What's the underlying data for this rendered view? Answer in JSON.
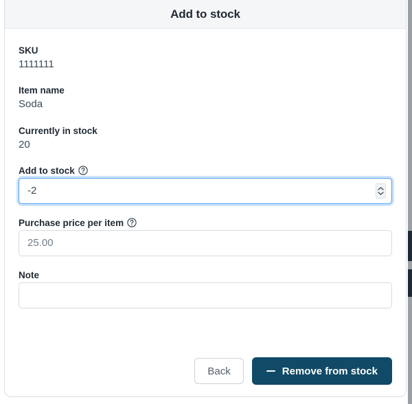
{
  "modal": {
    "title": "Add to stock"
  },
  "fields": {
    "sku": {
      "label": "SKU",
      "value": "1111111"
    },
    "item_name": {
      "label": "Item name",
      "value": "Soda"
    },
    "currently_in_stock": {
      "label": "Currently in stock",
      "value": "20"
    },
    "add_to_stock": {
      "label": "Add to stock",
      "help_icon": "help-circle-icon",
      "value": "-2",
      "placeholder": ""
    },
    "purchase_price": {
      "label": "Purchase price per item",
      "help_icon": "help-circle-icon",
      "value": "",
      "placeholder": "25.00"
    },
    "note": {
      "label": "Note",
      "value": "",
      "placeholder": ""
    }
  },
  "footer": {
    "back_label": "Back",
    "submit_label": "Remove from stock",
    "submit_icon": "minus-icon"
  },
  "colors": {
    "primary_button": "#104a66",
    "header_background": "#f5f6f7",
    "focus_border": "#4d9ff0",
    "focus_ring": "#cfe4fb",
    "text_primary": "#1f2933",
    "text_secondary": "#3c4a57"
  }
}
